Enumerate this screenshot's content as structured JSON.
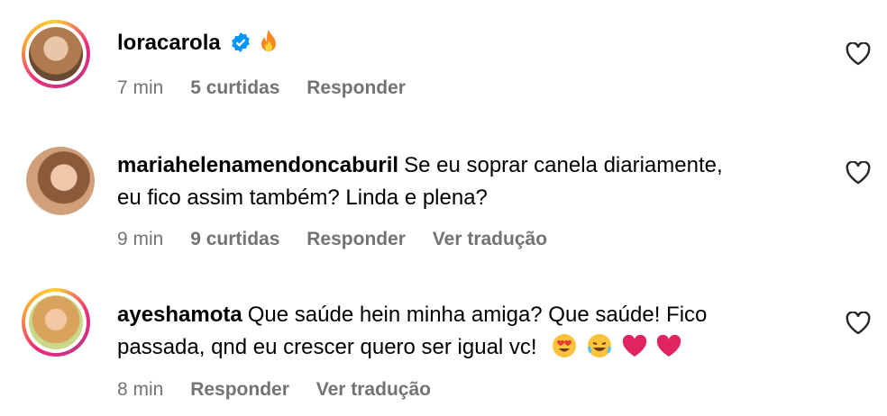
{
  "comments": [
    {
      "username": "loracarola",
      "verified": true,
      "text": "",
      "text_line2": "",
      "time": "7 min",
      "likes": "5 curtidas",
      "reply": "Responder",
      "translate": ""
    },
    {
      "username": "mariahelenamendoncaburil",
      "verified": false,
      "text": "Se eu soprar canela diariamente,",
      "text_line2": "eu fico assim também? Linda e plena?",
      "time": "9 min",
      "likes": "9 curtidas",
      "reply": "Responder",
      "translate": "Ver tradução"
    },
    {
      "username": "ayeshamota",
      "verified": false,
      "text": "Que saúde hein minha amiga? Que saúde! Fico",
      "text_line2": "passada, qnd eu crescer quero ser igual vc!",
      "time": "8 min",
      "likes": "",
      "reply": "Responder",
      "translate": "Ver tradução"
    }
  ],
  "icons": {
    "like": "heart-outline-icon",
    "verified": "verified-badge-icon",
    "fire": "fire-emoji",
    "emojis": [
      "heart-eyes-emoji",
      "laughing-emoji",
      "red-heart-emoji",
      "red-heart-emoji"
    ]
  },
  "colors": {
    "meta_text": "#737373",
    "verified_blue": "#0095f6",
    "heart_red": "#e0245e"
  }
}
